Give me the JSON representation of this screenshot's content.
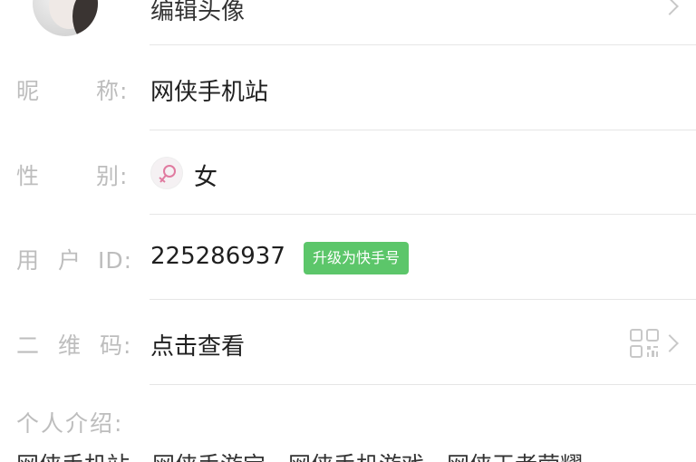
{
  "header_row": {
    "edit_avatar_label": "编辑头像"
  },
  "nickname": {
    "label": [
      "昵",
      "称:"
    ],
    "value": "网侠手机站"
  },
  "gender": {
    "label": [
      "性",
      "别:"
    ],
    "value": "女",
    "icon": "female-icon"
  },
  "user_id": {
    "label": [
      "用",
      "户",
      "ID:"
    ],
    "value": "225286937",
    "badge": "升级为快手号",
    "badge_color": "#5cc66a"
  },
  "qrcode": {
    "label": [
      "二",
      "维",
      "码:"
    ],
    "value": "点击查看",
    "icon": "qr-code-icon"
  },
  "intro": {
    "label": "个人介绍:",
    "text": "网侠手机站、网侠手游宝、网侠手机游戏、网侠王者荣耀"
  }
}
